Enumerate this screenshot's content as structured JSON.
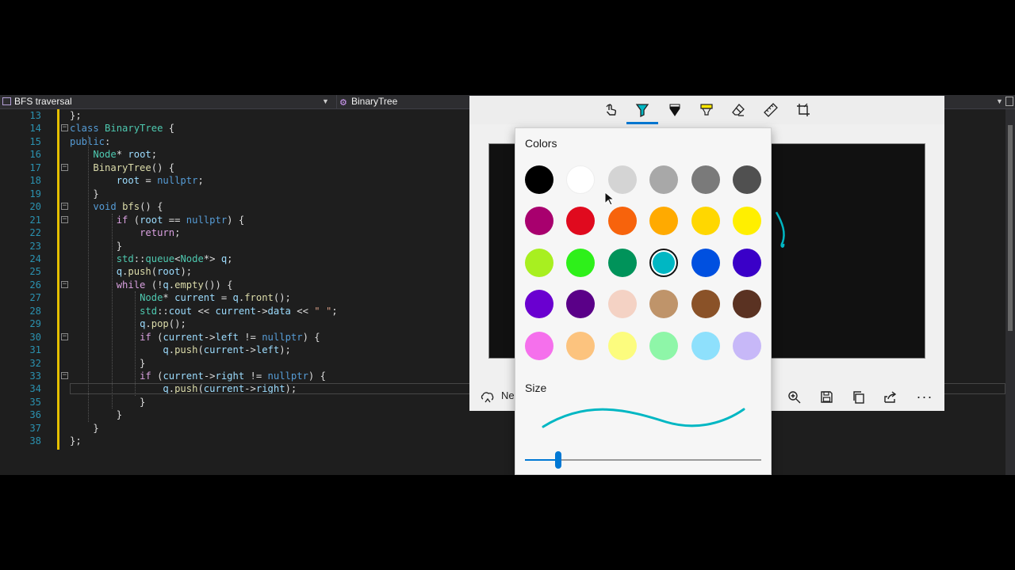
{
  "editor": {
    "nav_left_label": "BFS traversal",
    "nav_mid_label": "BinaryTree",
    "lines": [
      {
        "n": "13",
        "html": "};"
      },
      {
        "n": "14",
        "fold": true,
        "html": "<span class=\"kw\">class</span> <span class=\"ty\">BinaryTree</span> {"
      },
      {
        "n": "15",
        "html": "<span class=\"kw\">public</span>:"
      },
      {
        "n": "16",
        "html": "    <span class=\"ty\">Node</span>* <span class=\"var\">root</span>;"
      },
      {
        "n": "17",
        "fold": true,
        "html": "    <span class=\"fn\">BinaryTree</span>() {"
      },
      {
        "n": "18",
        "html": "        <span class=\"var\">root</span> = <span class=\"kw\">nullptr</span>;"
      },
      {
        "n": "19",
        "html": "    }"
      },
      {
        "n": "20",
        "fold": true,
        "html": "    <span class=\"kw\">void</span> <span class=\"fn\">bfs</span>() {"
      },
      {
        "n": "21",
        "fold": true,
        "html": "        <span class=\"ctl\">if</span> (<span class=\"var\">root</span> == <span class=\"kw\">nullptr</span>) {"
      },
      {
        "n": "22",
        "html": "            <span class=\"ctl\">return</span>;"
      },
      {
        "n": "23",
        "html": "        }"
      },
      {
        "n": "24",
        "html": "        <span class=\"ty\">std</span>::<span class=\"ty\">queue</span>&lt;<span class=\"ty\">Node</span>*&gt; <span class=\"var\">q</span>;"
      },
      {
        "n": "25",
        "html": "        <span class=\"var\">q</span>.<span class=\"fn\">push</span>(<span class=\"var\">root</span>);"
      },
      {
        "n": "26",
        "fold": true,
        "html": "        <span class=\"ctl\">while</span> (!<span class=\"var\">q</span>.<span class=\"fn\">empty</span>()) {"
      },
      {
        "n": "27",
        "html": "            <span class=\"ty\">Node</span>* <span class=\"var\">current</span> = <span class=\"var\">q</span>.<span class=\"fn\">front</span>();"
      },
      {
        "n": "28",
        "html": "            <span class=\"ty\">std</span>::<span class=\"var\">cout</span> &lt;&lt; <span class=\"var\">current</span>-&gt;<span class=\"var\">data</span> &lt;&lt; <span class=\"st\">\" \"</span>;"
      },
      {
        "n": "29",
        "html": "            <span class=\"var\">q</span>.<span class=\"fn\">pop</span>();"
      },
      {
        "n": "30",
        "fold": true,
        "html": "            <span class=\"ctl\">if</span> (<span class=\"var\">current</span>-&gt;<span class=\"var\">left</span> != <span class=\"kw\">nullptr</span>) {"
      },
      {
        "n": "31",
        "html": "                <span class=\"var\">q</span>.<span class=\"fn\">push</span>(<span class=\"var\">current</span>-&gt;<span class=\"var\">left</span>);"
      },
      {
        "n": "32",
        "html": "            }"
      },
      {
        "n": "33",
        "fold": true,
        "html": "            <span class=\"ctl\">if</span> (<span class=\"var\">current</span>-&gt;<span class=\"var\">right</span> != <span class=\"kw\">nullptr</span>) {"
      },
      {
        "n": "34",
        "html": "                <span class=\"var\">q</span>.<span class=\"fn\">push</span>(<span class=\"var\">current</span>-&gt;<span class=\"var\">right</span>);"
      },
      {
        "n": "35",
        "html": "            }"
      },
      {
        "n": "36",
        "html": "        }"
      },
      {
        "n": "37",
        "html": "    }"
      },
      {
        "n": "38",
        "html": "};"
      }
    ]
  },
  "snip": {
    "new_label": "Ne",
    "tools": [
      {
        "id": "touch-writing",
        "icon": "touch-writing-icon"
      },
      {
        "id": "ballpoint-pen",
        "icon": "ballpoint-pen-icon",
        "active": true
      },
      {
        "id": "pencil",
        "icon": "pencil-icon"
      },
      {
        "id": "highlighter",
        "icon": "highlighter-icon"
      },
      {
        "id": "eraser",
        "icon": "eraser-icon"
      },
      {
        "id": "ruler",
        "icon": "ruler-icon"
      },
      {
        "id": "crop",
        "icon": "crop-icon"
      }
    ]
  },
  "flyout": {
    "colors_title": "Colors",
    "size_title": "Size",
    "selected_color": "#00b7c3",
    "size_value_fraction": 0.14,
    "swatches": [
      [
        "#000000",
        "#ffffff",
        "#d4d4d4",
        "#a8a8a8",
        "#7a7a7a",
        "#505050"
      ],
      [
        "#a8006e",
        "#e00a1e",
        "#f7630c",
        "#ffaa00",
        "#ffd700",
        "#ffef00"
      ],
      [
        "#a8ef20",
        "#2ef01a",
        "#00935a",
        "#00b7c3",
        "#0050e0",
        "#3a00c8"
      ],
      [
        "#6a00d0",
        "#5a0088",
        "#f4d2c4",
        "#bf946a",
        "#8a5228",
        "#5a3222"
      ],
      [
        "#f570ec",
        "#fcc37e",
        "#fcfc7e",
        "#8ef6a8",
        "#8ee0fc",
        "#c7b8f8"
      ]
    ]
  }
}
